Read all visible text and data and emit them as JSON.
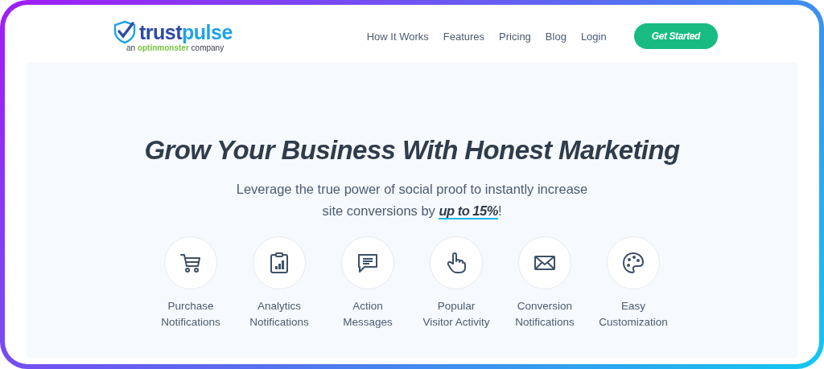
{
  "logo": {
    "brand_part_1": "trust",
    "brand_part_2": "pulse",
    "tagline_prefix": "an",
    "tagline_brand": "optinmonster",
    "tagline_suffix": "company"
  },
  "nav": {
    "links": [
      "How It Works",
      "Features",
      "Pricing",
      "Blog",
      "Login"
    ],
    "cta": "Get Started"
  },
  "hero": {
    "headline": "Grow Your Business With Honest Marketing",
    "subtitle": "Leverage the true power of social proof to instantly increase site conversions by **up to 15%**!"
  },
  "features": [
    {
      "kind": "cart",
      "label_line_1": "Purchase",
      "label_line_2": "Notifications"
    },
    {
      "kind": "analytics",
      "label_line_1": "Analytics",
      "label_line_2": "Notifications"
    },
    {
      "kind": "message",
      "label_line_1": "Action",
      "label_line_2": "Messages"
    },
    {
      "kind": "pointer",
      "label_line_1": "Popular",
      "label_line_2": "Visitor Activity"
    },
    {
      "kind": "envelope",
      "label_line_1": "Conversion",
      "label_line_2": "Notifications"
    },
    {
      "kind": "palette",
      "label_line_1": "Easy",
      "label_line_2": "Customization"
    }
  ]
}
